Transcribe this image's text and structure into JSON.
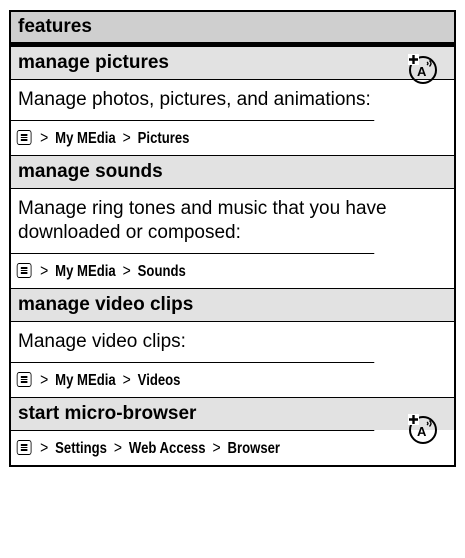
{
  "header": {
    "title": "features"
  },
  "features": [
    {
      "title": "manage pictures",
      "description": "Manage photos, pictures, and animations:",
      "path": [
        "My MEdia",
        "Pictures"
      ],
      "network_icon": true
    },
    {
      "title": "manage sounds",
      "description": "Manage ring tones and music that you have downloaded or composed:",
      "path": [
        "My MEdia",
        "Sounds"
      ],
      "network_icon": false
    },
    {
      "title": "manage video clips",
      "description": "Manage video clips:",
      "path": [
        "My MEdia",
        "Videos"
      ],
      "network_icon": false
    },
    {
      "title": "start micro-browser",
      "description": "",
      "path": [
        "Settings",
        "Web Access",
        "Browser"
      ],
      "network_icon": true
    }
  ],
  "separator": ">",
  "icons": {
    "menu_key": "menu-key-icon",
    "network": "network-dependent-icon"
  }
}
